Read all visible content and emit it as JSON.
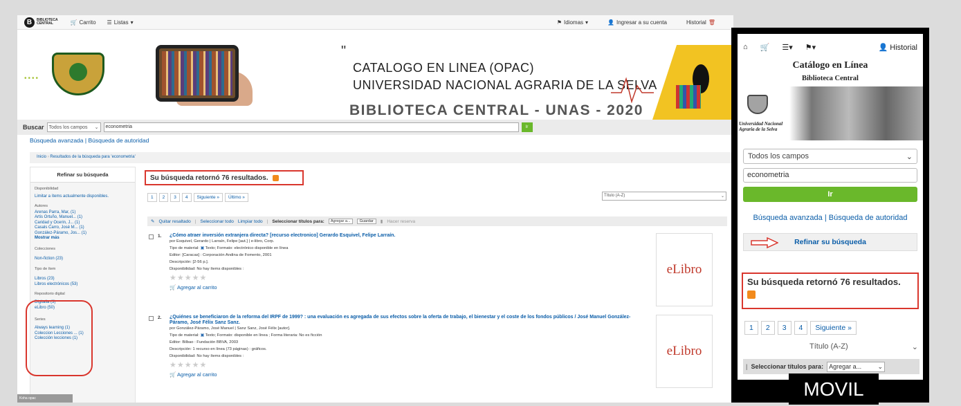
{
  "desktop": {
    "nav": {
      "logo_line1": "BIBLIOTECA",
      "logo_line2": "CENTRAL",
      "cart": "Carrito",
      "lists": "Listas",
      "languages": "Idiomas",
      "login": "Ingresar a su cuenta",
      "history": "Historial"
    },
    "banner": {
      "line1": "CATALOGO EN LINEA (OPAC)",
      "line2": "UNIVERSIDAD NACIONAL AGRARIA DE LA SELVA",
      "line3": "BIBLIOTECA CENTRAL - UNAS - 2020"
    },
    "search": {
      "label": "Buscar",
      "field": "Todos los campos",
      "query": "econometria",
      "go": "Ir"
    },
    "advanced": "Búsqueda avanzada",
    "authority": "Búsqueda de autoridad",
    "breadcrumb": {
      "home": "Inicio",
      "results": "Resultados de la búsqueda para 'econometria'"
    },
    "refine": {
      "title": "Refinar su búsqueda",
      "availability_title": "Disponibilidad",
      "availability_link": "Limitar a ítems actualmente disponibles.",
      "authors_title": "Autores",
      "authors": [
        "Arenas Parra, Mar, (1)",
        "Artis Ortuño, Manuel... (1)",
        "Caridad y Ocerin, J... (1)",
        "Casals Carro, José M... (1)",
        "González-Páramo, Jos... (1)"
      ],
      "show_more": "Mostrar más",
      "collections_title": "Colecciones",
      "collections": [
        "Non-fiction (23)"
      ],
      "itemtype_title": "Tipo de ítem",
      "itemtypes": [
        "Libros (23)",
        "Libros electrónicos (53)"
      ],
      "repo_title": "Repositorio digital",
      "repos": [
        "Digitalia (3)",
        "eLibro (50)"
      ],
      "series_title": "Series",
      "series": [
        "Always learning (1)",
        "Coleccion Lecciones ... (1)",
        "Colección lecciones (1)"
      ]
    },
    "results_text": "Su búsqueda retornó 76 resultados.",
    "pagination": [
      "1",
      "2",
      "3",
      "4",
      "Siguiente »",
      "Último »"
    ],
    "sort": "Título (A-Z)",
    "toolbar": {
      "unhighlight": "Quitar resaltado",
      "select_all": "Seleccionar todo",
      "clear_all": "Limpiar todo",
      "select_for": "Seleccionar títulos para:",
      "add_to": "Agregar a...",
      "save": "Guardar",
      "place_hold": "Hacer reserva"
    },
    "records": [
      {
        "num": "1.",
        "title": "¿Cómo atraer inversión extranjera directa? [recurso electronico] Gerardo Esquivel, Felipe Larraín.",
        "by": "por Esquivel, Gerardo | Larraín, Felipe [aut.] | e-libro, Corp.",
        "type": "Tipo de material:",
        "type_val": "Texto; Formato: electrónico disponible en línea",
        "publisher": "Editor: [Caracas] : Corporación Andina de Fomento, 2001",
        "desc": "Descripción: [2-56 p.].",
        "avail": "Disponibilidad: No hay ítems disponibles :",
        "cart": "Agregar al carrito",
        "cover": "eLibro"
      },
      {
        "num": "2.",
        "title": "¿Quiénes se beneficiaron de la reforma del IRPF de 1999? : una evaluación es agregada de sus efectos sobre la oferta de trabajo, el bienestar y el coste de los fondos públicos / José Manuel González-Páramo, José Félix Sanz Sanz.",
        "by": "por González-Páramo, José Manuel | Sanz Sanz, José Félix [autor].",
        "type": "Tipo de material:",
        "type_val": "Texto; Formato: disponible en línea ; Forma literaria: No es ficción",
        "publisher": "Editor: Bilbao : Fundación BBVA, 2003",
        "desc": "Descripción: 1 recurso en línea (73 páginas) : gráficos.",
        "avail": "Disponibilidad: No hay ítems disponibles :",
        "cart": "Agregar al carrito",
        "cover": "eLibro"
      }
    ],
    "corner": "Koha opac"
  },
  "mobile": {
    "history": "Historial",
    "title": "Catálogo en Línea",
    "subtitle": "Biblioteca Central",
    "uni_line1": "Universidad Nacional",
    "uni_line2": "Agraria de la Selva",
    "field": "Todos los campos",
    "query": "econometria",
    "go": "Ir",
    "advanced": "Búsqueda avanzada | Búsqueda de autoridad",
    "refine": "Refinar su búsqueda",
    "results_text": "Su búsqueda retornó 76 resultados.",
    "pagination": [
      "1",
      "2",
      "3",
      "4",
      "Siguiente »"
    ],
    "sort": "Título (A-Z)",
    "select_for": "Seleccionar títulos para:",
    "add_to": "Agregar a..."
  },
  "label": "MOVIL",
  "colors": {
    "link": "#0a5da8",
    "highlight": "#d9362d",
    "go_button": "#6ab82b",
    "rss": "#f28a1c"
  }
}
